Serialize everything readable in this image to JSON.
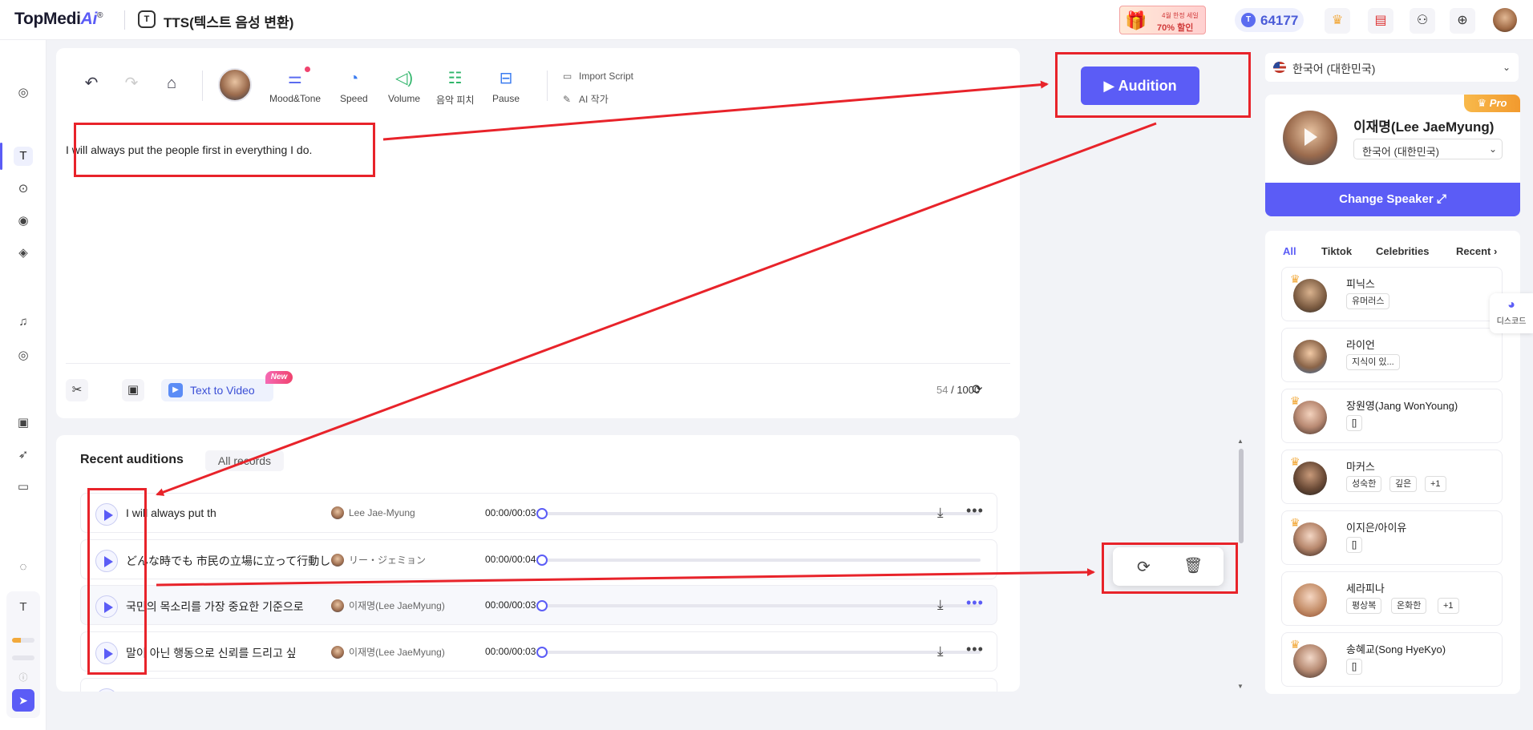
{
  "header": {
    "logo_main": "TopMedi",
    "logo_ai": "Ai",
    "logo_reg": "®",
    "tts_icon": "T",
    "title": "TTS(텍스트 음성 변환)",
    "promo_line1": "4월 한정 세일",
    "promo_line2": "70% 할인",
    "credits": "64177",
    "icons": [
      "crown-icon",
      "calendar-icon",
      "network-icon",
      "globe-icon"
    ]
  },
  "toolbar": {
    "mood": "Mood&Tone",
    "speed": "Speed",
    "volume": "Volume",
    "pitch": "음악 피치",
    "pause": "Pause",
    "import_script": "Import Script",
    "ai_writer": "AI 작가"
  },
  "audition_label": "Audition",
  "script_text": "I will always put the people first in everything I do.",
  "bottom_tools": {
    "text_to_video": "Text to Video",
    "new_badge": "New",
    "char_current": "54",
    "char_sep": " / ",
    "char_max": "1000"
  },
  "recent": {
    "title": "Recent auditions",
    "all_records": "All records",
    "rows": [
      {
        "text": "I will always put th",
        "voice": "Lee Jae-Myung",
        "time": "00:00/00:03"
      },
      {
        "text": "どんな時でも 市民の立場に立って行動しま",
        "voice": "リー・ジェミョン",
        "time": "00:00/00:04"
      },
      {
        "text": "국민의 목소리를 가장 중요한 기준으로",
        "voice": "이재명(Lee JaeMyung)",
        "time": "00:00/00:03"
      },
      {
        "text": "말이 아닌 행동으로 신뢰를 드리고 싶",
        "voice": "이재명(Lee JaeMyung)",
        "time": "00:00/00:03"
      }
    ]
  },
  "right": {
    "language": "한국어 (대한민국)",
    "pro": "Pro",
    "speaker_name": "이재명(Lee JaeMyung)",
    "speaker_lang": "한국어 (대한민국)",
    "change_speaker": "Change Speaker",
    "tabs": [
      "All",
      "Tiktok",
      "Celebrities",
      "Recent"
    ],
    "voices": [
      {
        "name": "피닉스",
        "tags": [
          "유머러스"
        ],
        "crown": true
      },
      {
        "name": "라이언",
        "tags": [
          "지식이 있..."
        ],
        "crown": false
      },
      {
        "name": "장원영(Jang WonYoung)",
        "tags": [
          "[]"
        ],
        "crown": true
      },
      {
        "name": "마커스",
        "tags": [
          "성숙한",
          "깊은",
          "+1"
        ],
        "crown": true
      },
      {
        "name": "이지은/아이유",
        "tags": [
          "[]"
        ],
        "crown": true
      },
      {
        "name": "세라피나",
        "tags": [
          "평상복",
          "온화한",
          "+1"
        ],
        "crown": false
      },
      {
        "name": "송혜교(Song HyeKyo)",
        "tags": [
          "[]"
        ],
        "crown": true
      }
    ],
    "discord": "디스코드"
  },
  "colors": {
    "accent": "#5b5cf6",
    "annotation": "#e8232a"
  }
}
